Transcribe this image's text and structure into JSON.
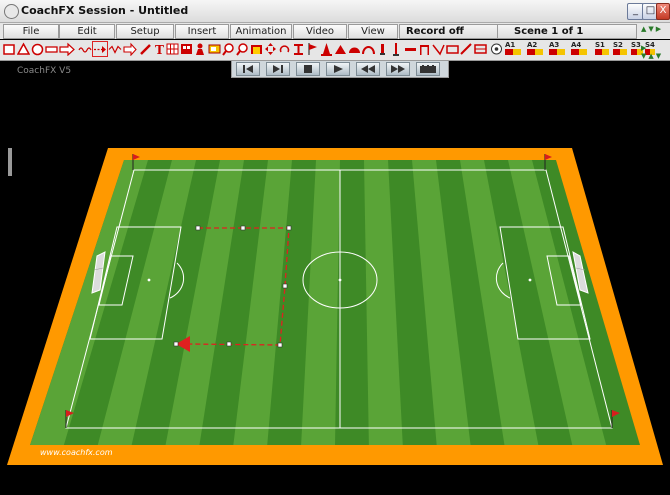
{
  "window": {
    "title": "CoachFX Session - Untitled",
    "controls": [
      "_",
      "□",
      "X"
    ]
  },
  "menu": {
    "items": [
      "File",
      "Edit",
      "Setup",
      "Insert",
      "Animation",
      "Video",
      "View"
    ],
    "record_status": "Record off",
    "scene_label": "Scene  1 of 1"
  },
  "toolbar": {
    "tools": [
      "square-tool",
      "triangle-tool",
      "circle-tool",
      "bar-tool",
      "arrow-tool",
      "dribble-path-tool",
      "pass-path-tool",
      "run-path-tool",
      "zigzag-arrow-tool",
      "pencil-tool",
      "text-tool",
      "grid-tool",
      "scoreboard-tool",
      "player-tool",
      "video-tool",
      "zoom-in-tool",
      "zoom-out-tool",
      "goal-tool",
      "move-tool",
      "rotate-tool",
      "mannequin-tool",
      "flag-tool",
      "cone-tool",
      "disc-tool",
      "half-disc-tool",
      "arc-tool",
      "marker-tool",
      "pole-tool",
      "line-tool",
      "hurdle-tool",
      "ladder-tool",
      "mini-goal-tool",
      "rebounder-tool",
      "bench-tool",
      "ball-tool"
    ],
    "team_a_labels": [
      "A1",
      "A2",
      "A3",
      "A4"
    ],
    "team_s_labels": [
      "S1",
      "S2",
      "S3",
      "S4"
    ],
    "selected_tool": "dribble-path-tool"
  },
  "canvas": {
    "watermark": "CoachFX V5",
    "website": "www.coachfx.com",
    "pitch_colors": {
      "border": "#ff9900",
      "grass_dark": "#3e8a26",
      "grass_light": "#5aa437",
      "lines": "#ffffff",
      "flag": "#d81d1d",
      "path": "#e02020"
    }
  },
  "playback": {
    "buttons": [
      "skip-start",
      "step-forward",
      "stop",
      "play",
      "rewind",
      "fast-forward",
      "film"
    ]
  }
}
